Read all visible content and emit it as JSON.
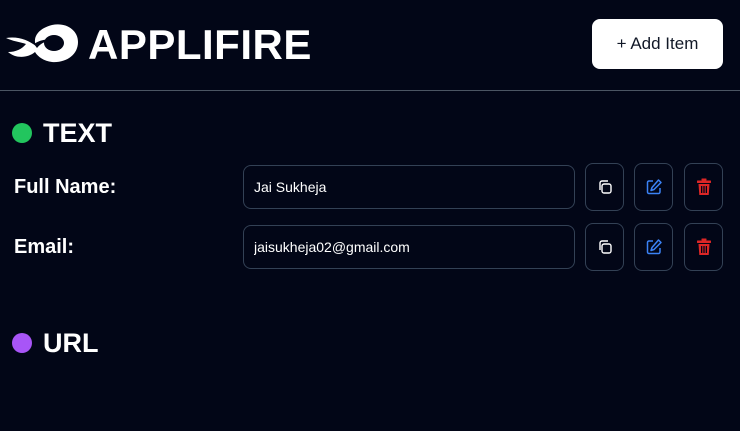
{
  "header": {
    "brand": "APPLIFIRE",
    "add_button_label": "+ Add Item"
  },
  "sections": [
    {
      "title": "TEXT",
      "dot_color": "#22c55e",
      "fields": [
        {
          "label": "Full Name:",
          "value": "Jai Sukheja"
        },
        {
          "label": "Email:",
          "value": "jaisukheja02@gmail.com"
        }
      ]
    },
    {
      "title": "URL",
      "dot_color": "#a855f7",
      "fields": []
    }
  ],
  "icons": {
    "logo": "flame-logo-icon",
    "copy": "copy-icon",
    "edit": "edit-icon",
    "delete": "trash-icon"
  },
  "colors": {
    "background": "#020617",
    "edit_icon": "#3b82f6",
    "delete_icon": "#dc2626"
  }
}
